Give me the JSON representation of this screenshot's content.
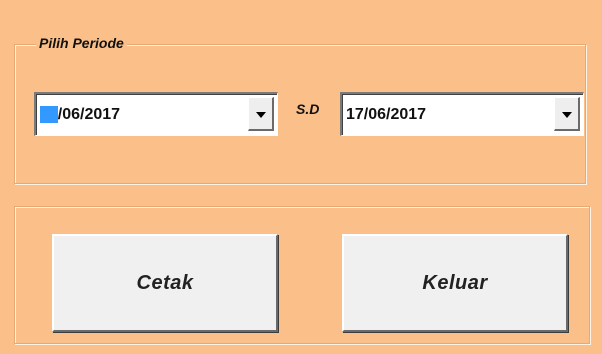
{
  "period_group": {
    "legend": "Pilih Periode",
    "start_date": {
      "selected_part": "17",
      "rest": "/06/2017"
    },
    "separator_label": "S.D",
    "end_date": {
      "value": "17/06/2017"
    }
  },
  "actions": {
    "print_label": "Cetak",
    "exit_label": "Keluar"
  },
  "colors": {
    "form_background": "#fbc089",
    "selection_highlight": "#3399ff",
    "button_face": "#f0f0f0"
  },
  "icons": {
    "dropdown": "chevron-down-icon"
  }
}
